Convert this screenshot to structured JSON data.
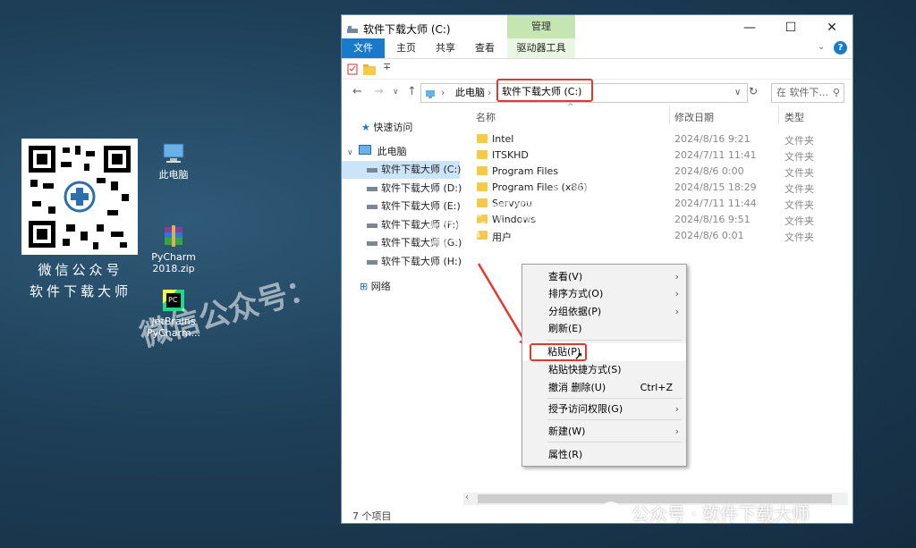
{
  "desktop": {
    "qr_caption_line1": "微信公众号",
    "qr_caption_line2": "软件下载大师",
    "icons": [
      {
        "label": "此电脑",
        "icon": "computer-icon"
      },
      {
        "label": "PyCharm\n2018.zip",
        "icon": "winrar-archive-icon"
      },
      {
        "label": "JetBrains\nPyCharm...",
        "icon": "pycharm-icon"
      }
    ]
  },
  "window": {
    "title": "软件下载大师 (C:)",
    "manage_label": "管理",
    "ribbon_tabs": [
      "文件",
      "主页",
      "共享",
      "查看",
      "驱动器工具"
    ],
    "qat_caret": "∓",
    "address_this_pc": "此电脑",
    "address_current": "软件下载大师 (C:)",
    "search_placeholder": "在 软件下... ",
    "nav": {
      "quick_access": "快速访问",
      "this_pc": "此电脑",
      "drives": [
        "软件下载大师 (C:)",
        "软件下载大师 (D:)",
        "软件下载大师 (E:)",
        "软件下载大师 (F:)",
        "软件下载大师 (G:)",
        "软件下载大师 (H:)"
      ],
      "network": "网络"
    },
    "columns": {
      "name": "名称",
      "date": "修改日期",
      "type": "类型"
    },
    "files": [
      {
        "name": "Intel",
        "date": "2024/8/16 9:21",
        "type": "文件夹"
      },
      {
        "name": "ITSKHD",
        "date": "2024/7/11 11:41",
        "type": "文件夹"
      },
      {
        "name": "Program Files",
        "date": "2024/8/6 0:00",
        "type": "文件夹"
      },
      {
        "name": "Program Files (x86)",
        "date": "2024/8/15 18:29",
        "type": "文件夹"
      },
      {
        "name": "Servyou",
        "date": "2024/7/11 11:44",
        "type": "文件夹"
      },
      {
        "name": "Windows",
        "date": "2024/8/16 9:51",
        "type": "文件夹"
      },
      {
        "name": "用户",
        "date": "2024/8/6 0:01",
        "type": "文件夹"
      }
    ],
    "status": "7 个项目"
  },
  "context_menu": {
    "items": [
      {
        "label": "查看(V)",
        "shortcut": "",
        "submenu": true
      },
      {
        "label": "排序方式(O)",
        "shortcut": "",
        "submenu": true
      },
      {
        "label": "分组依据(P)",
        "shortcut": "",
        "submenu": true
      },
      {
        "label": "刷新(E)",
        "shortcut": "",
        "submenu": false
      },
      {
        "label": "粘贴(P)",
        "shortcut": "",
        "submenu": false
      },
      {
        "label": "粘贴快捷方式(S)",
        "shortcut": "",
        "submenu": false
      },
      {
        "label": "撤消 删除(U)",
        "shortcut": "Ctrl+Z",
        "submenu": false
      },
      {
        "label": "授予访问权限(G)",
        "shortcut": "",
        "submenu": true
      },
      {
        "label": "新建(W)",
        "shortcut": "",
        "submenu": true
      },
      {
        "label": "属性(R)",
        "shortcut": "",
        "submenu": false
      }
    ]
  },
  "watermarks": {
    "diagonal_left": "微信公众号：",
    "diagonal_right": "软件下载大师",
    "bottom_right": "公众号 · 软件下载大师"
  },
  "colors": {
    "accent_blue": "#1979ca",
    "manage_tab": "#c5e6b3",
    "highlight_red": "#e03a2e",
    "folder_yellow": "#f5c94a"
  }
}
